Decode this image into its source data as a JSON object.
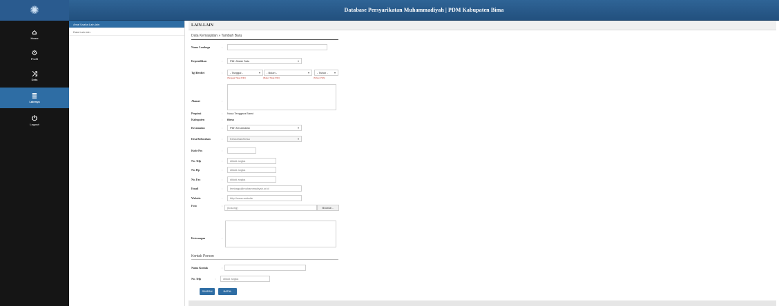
{
  "app": {
    "title": "Database Persyarikatan Muhammadiyah | PDM Kabupaten Bima"
  },
  "rail": {
    "logo_icon": "sun-logo-icon",
    "items": [
      {
        "label": "Home",
        "icon": "home-icon",
        "active": false
      },
      {
        "label": "Profil",
        "icon": "settings-icon",
        "active": false
      },
      {
        "label": "Data",
        "icon": "shuffle-icon",
        "active": false
      },
      {
        "label": "Lainnya",
        "icon": "list-icon",
        "active": true
      },
      {
        "label": "Logout",
        "icon": "power-icon",
        "active": false
      }
    ]
  },
  "submenu": {
    "items": [
      {
        "label": "Amal Usaha Lain-lain",
        "active": true
      },
      {
        "label": "Data Lain-lain",
        "active": false
      }
    ]
  },
  "panel": {
    "heading": "LAIN-LAIN",
    "section_title": "Data Kemasjidan » Tambah Baru",
    "contact_section_title": "Kontak Person"
  },
  "form": {
    "nama_label": "Nama Lembaga",
    "nama_value": "",
    "kepemilikan_label": "Kepemilikan",
    "kepemilikan_value": "Pilih Salah Satu",
    "tgl_label": "Tgl Berdiri",
    "tgl_day": "- Tanggal -",
    "tgl_month": "- Bulan -",
    "tgl_year": "- Tahun -",
    "hint_day": "[Tanggal Tidak Pilih]",
    "hint_month": "[Bulan Tidak Pilih]",
    "hint_year": "[Tahun Pilih]",
    "alamat_label": "Alamat",
    "propinsi_label": "Propinsi",
    "propinsi_value": "Nusa Tenggara Barat",
    "kabupaten_label": "Kabupaten",
    "kabupaten_value": "Bima",
    "kecamatan_label": "Kecamatan",
    "kecamatan_value": "Pilih Kecamatan",
    "kelurahan_label": "Desa/Kelurahan",
    "kelurahan_value": "Kelurahan/Desa",
    "kodepos_label": "Kode Pos",
    "kodepos_value": "",
    "telp_label": "No. Telp",
    "telp_placeholder": "diikuti angka",
    "hp_label": "No. Hp",
    "hp_placeholder": "diikuti angka",
    "fax_label": "No. Fax",
    "fax_placeholder": "diikuti angka",
    "email_label": "Email",
    "email_value": "lembaga@muhammadiyah.or.id",
    "website_label": "Website",
    "website_value": "http://www.website",
    "foto_label": "Foto",
    "foto_placeholder": "(kosong)",
    "foto_button": "Browse...",
    "keterangan_label": "Keterangan",
    "kontak_nama_label": "Nama Kontak",
    "kontak_nama_value": "",
    "kontak_hp_label": "No. Telp",
    "kontak_hp_placeholder": "diikuti angka"
  },
  "buttons": {
    "simpan": "SIMPAN",
    "batal": "BATAL"
  }
}
